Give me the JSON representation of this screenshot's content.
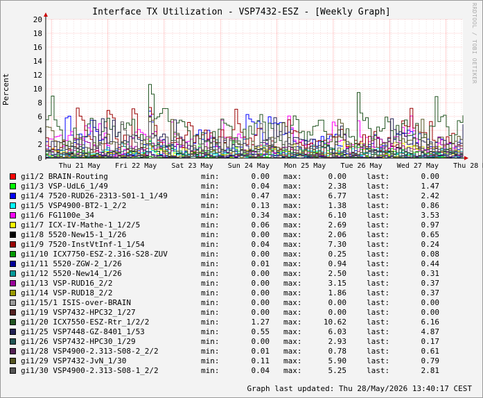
{
  "chart_data": {
    "type": "line",
    "title": "Interface TX Utilization - VSP7432-ESZ - [Weekly Graph]",
    "ylabel": "Percent",
    "xlabel": "",
    "ylim": [
      0,
      20
    ],
    "y_ticks": [
      "0",
      "2",
      "4",
      "6",
      "8",
      "10",
      "12",
      "14",
      "16",
      "18",
      "20"
    ],
    "x_ticks": [
      "Thu 21 May",
      "Fri 22 May",
      "Sat 23 May",
      "Sun 24 May",
      "Mon 25 May",
      "Tue 26 May",
      "Wed 27 May",
      "Thu 28 May"
    ],
    "grid": true,
    "legend_position": "bottom",
    "series": [
      {
        "name": "gi1/2 BRAIN-Routing",
        "color": "#ff0000",
        "min": "0.00",
        "max": "0.00",
        "last": "0.00"
      },
      {
        "name": "gi1/3 VSP-UdL6_1/49",
        "color": "#00ff00",
        "min": "0.04",
        "max": "2.38",
        "last": "1.47"
      },
      {
        "name": "gi1/4 7520-RUD26-2313-S01-1_1/49",
        "color": "#0000ff",
        "min": "0.47",
        "max": "6.77",
        "last": "2.42"
      },
      {
        "name": "gi1/5 VSP4900-BT2-1_2/2",
        "color": "#00ffff",
        "min": "0.13",
        "max": "1.38",
        "last": "0.86"
      },
      {
        "name": "gi1/6 FG1100e_34",
        "color": "#ff00ff",
        "min": "0.34",
        "max": "6.10",
        "last": "3.53"
      },
      {
        "name": "gi1/7 ICX-IV-Mathe-1_1/2/5",
        "color": "#ffff00",
        "min": "0.06",
        "max": "2.69",
        "last": "0.97"
      },
      {
        "name": "gi1/8 5520-New15-1_1/26",
        "color": "#000000",
        "min": "0.00",
        "max": "2.06",
        "last": "0.65"
      },
      {
        "name": "gi1/9 7520-InstVtInf-1_1/54",
        "color": "#990000",
        "min": "0.04",
        "max": "7.30",
        "last": "0.24"
      },
      {
        "name": "gi1/10 ICX7750-ESZ-2.316-S28-ZUV",
        "color": "#009900",
        "min": "0.00",
        "max": "0.25",
        "last": "0.08"
      },
      {
        "name": "gi1/11 5520-ZGW-2_1/26",
        "color": "#000099",
        "min": "0.01",
        "max": "0.94",
        "last": "0.44"
      },
      {
        "name": "gi1/12 5520-New14_1/26",
        "color": "#009999",
        "min": "0.00",
        "max": "2.50",
        "last": "0.31"
      },
      {
        "name": "gi1/13 VSP-RUD16_2/2",
        "color": "#990099",
        "min": "0.00",
        "max": "3.15",
        "last": "0.37"
      },
      {
        "name": "gi1/14 VSP-RUD18_2/2",
        "color": "#999900",
        "min": "0.00",
        "max": "1.86",
        "last": "0.37"
      },
      {
        "name": "gi1/15/1 ISIS-over-BRAIN",
        "color": "#999999",
        "min": "0.00",
        "max": "0.00",
        "last": "0.00"
      },
      {
        "name": "gi1/19 VSP7432-HPC32_1/27",
        "color": "#552222",
        "min": "0.00",
        "max": "0.00",
        "last": "0.00"
      },
      {
        "name": "gi1/20 ICX7550-ESZ-Rtr_1/2/2",
        "color": "#225522",
        "min": "1.27",
        "max": "10.62",
        "last": "6.16"
      },
      {
        "name": "gi1/25 VSP7448-GZ-8401_1/53",
        "color": "#222255",
        "min": "0.55",
        "max": "6.03",
        "last": "4.87"
      },
      {
        "name": "gi1/26 VSP7432-HPC30_1/29",
        "color": "#225555",
        "min": "0.00",
        "max": "2.93",
        "last": "0.17"
      },
      {
        "name": "gi1/28 VSP4900-2.313-S08-2_2/2",
        "color": "#552255",
        "min": "0.01",
        "max": "0.78",
        "last": "0.61"
      },
      {
        "name": "gi1/29 VSP7432-JvN_1/30",
        "color": "#555522",
        "min": "0.11",
        "max": "5.90",
        "last": "0.79"
      },
      {
        "name": "gi1/30 VSP4900-2.313-S08-1_2/2",
        "color": "#555555",
        "min": "0.04",
        "max": "5.25",
        "last": "2.81"
      }
    ]
  },
  "legend_labels": {
    "min": "min:",
    "max": "max:",
    "last": "last:"
  },
  "footer": "Graph last updated: Thu 28/May/2026 13:40:17 CEST",
  "watermark": "RRDTOOL / TOBI OETIKER"
}
